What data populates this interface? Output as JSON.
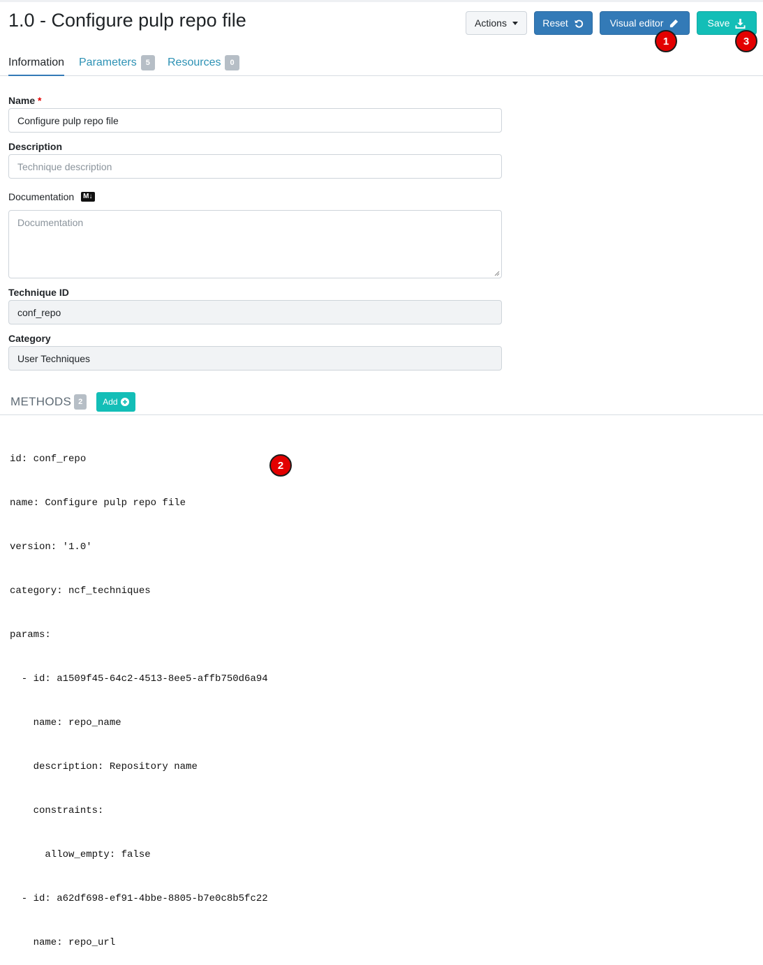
{
  "header": {
    "title": "1.0 - Configure pulp repo file",
    "actions_label": "Actions",
    "reset_label": "Reset",
    "visual_editor_label": "Visual editor",
    "save_label": "Save"
  },
  "markers": [
    "1",
    "2",
    "3"
  ],
  "tabs": [
    {
      "label": "Information"
    },
    {
      "label": "Parameters",
      "count": "5"
    },
    {
      "label": "Resources",
      "count": "0"
    }
  ],
  "form": {
    "name_label": "Name",
    "required_mark": "*",
    "name_value": "Configure pulp repo file",
    "description_label": "Description",
    "description_placeholder": "Technique description",
    "documentation_label": "Documentation",
    "markdown_badge": "M↓",
    "documentation_placeholder": "Documentation",
    "technique_id_label": "Technique ID",
    "technique_id_value": "conf_repo",
    "category_label": "Category",
    "category_value": "User Techniques"
  },
  "methods": {
    "title": "METHODS",
    "count": "2",
    "add_label": "Add"
  },
  "yaml_lines": [
    "id: conf_repo",
    "name: Configure pulp repo file",
    "version: '1.0'",
    "category: ncf_techniques",
    "params:",
    "  - id: a1509f45-64c2-4513-8ee5-affb750d6a94",
    "    name: repo_name",
    "    description: Repository name",
    "    constraints:",
    "      allow_empty: false",
    "  - id: a62df698-ef91-4bbe-8805-b7e0c8b5fc22",
    "    name: repo_url"
  ],
  "colors": {
    "primary": "#337ab7",
    "teal": "#13beb7",
    "marker": "#e30000",
    "link": "#2c91b4"
  }
}
